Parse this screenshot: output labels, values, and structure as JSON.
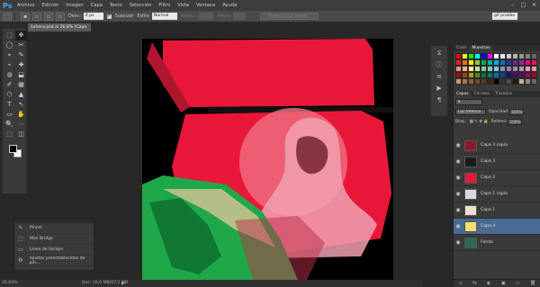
{
  "menubar": {
    "logo": "Ps",
    "items": [
      "Archivo",
      "Edición",
      "Imagen",
      "Capa",
      "Texto",
      "Selección",
      "Filtro",
      "Vista",
      "Ventana",
      "Ayuda"
    ],
    "win_controls": [
      "–",
      "□",
      "✕"
    ]
  },
  "options": {
    "difuminar_label": "Desv.:",
    "difuminar_value": "0 px",
    "suavizar_label": "Suavizar",
    "estilo_label": "Estilo:",
    "estilo_value": "Normal",
    "anchura_label": "Anchu.:",
    "altura_label": "Altura:",
    "refine_button": "Perfeccionar borde...",
    "preset_value": "gif prueba"
  },
  "document": {
    "tab_title": "liuhera.psd al 26,8% (Capa 4, RGB/8)",
    "tab_close": "×",
    "zoom": "26,84%",
    "doc_info": "Doc: 16,0 MB/67,2 MB"
  },
  "float_panel": {
    "items": [
      {
        "icon": "✎",
        "label": "Pincel"
      },
      {
        "icon": "⬚",
        "label": "Mini Bridge"
      },
      {
        "icon": "▭",
        "label": "Línea de tiempo"
      },
      {
        "icon": "⚙",
        "label": "Ajustes preestablecidos de pin..."
      }
    ]
  },
  "right_panel": {
    "color_tabs": [
      "Color",
      "Muestras"
    ],
    "layer_tabs": [
      "Capas",
      "Canales",
      "Trazados"
    ],
    "blend_mode": "Luz intensa",
    "opacity_label": "Opacidad:",
    "opacity_value": "100%",
    "lock_label": "Bloq.:",
    "fill_label": "Relleno:",
    "fill_value": "100%",
    "layers": [
      {
        "name": "Capa 3 copia",
        "color": "#8a1a2a",
        "selected": false
      },
      {
        "name": "Capa 3",
        "color": "#1a1a1a",
        "selected": false
      },
      {
        "name": "Capa 2",
        "color": "#e8173a",
        "selected": false
      },
      {
        "name": "Capa 1 copia",
        "color": "#d9d9d9",
        "selected": false
      },
      {
        "name": "Capa 1",
        "color": "#e8e0c8",
        "selected": false
      },
      {
        "name": "Capa 4",
        "color": "#f0e070",
        "selected": true
      },
      {
        "name": "Fondo",
        "color": "#2b6a5a",
        "selected": false
      }
    ],
    "footer_icons": [
      "∞",
      "fx",
      "◐",
      "▣",
      "▭",
      "🗑"
    ]
  },
  "swatch_colors": [
    "#ff0000",
    "#ffff00",
    "#00ff00",
    "#00ffff",
    "#0000ff",
    "#ff00ff",
    "#ffffff",
    "#e6e6e6",
    "#cccccc",
    "#b3b3b3",
    "#999999",
    "#808080",
    "#666666",
    "#ed1c24",
    "#f26522",
    "#fff200",
    "#8dc63f",
    "#00a651",
    "#00a99d",
    "#00aeef",
    "#0072bc",
    "#2e3192",
    "#662d91",
    "#92278f",
    "#ec008c",
    "#ed145b",
    "#f7977a",
    "#fbad82",
    "#fff799",
    "#c4df9b",
    "#82ca9c",
    "#7accc8",
    "#6dcff6",
    "#8393ca",
    "#8781bd",
    "#a187be",
    "#bd8cbf",
    "#f49ac1",
    "#f6989d",
    "#9e0b0f",
    "#a0410d",
    "#aba000",
    "#598527",
    "#007236",
    "#00746b",
    "#0076a3",
    "#004a80",
    "#1b1464",
    "#440e62",
    "#630460",
    "#9e005d",
    "#9e0039",
    "#c69c6d",
    "#a67c52",
    "#8c6239",
    "#754c24",
    "#603913",
    "#3c2415",
    "#000000",
    "#333333",
    "#4d4d4d",
    "#1a1a1a",
    "#c7b299",
    "#998675",
    "#736357"
  ],
  "tools": [
    "⬚",
    "✥",
    "◯",
    "✂",
    "⌖",
    "✎",
    "⌁",
    "✚",
    "◍",
    "⬓",
    "✐",
    "▦",
    "⬡",
    "▲",
    "T",
    "↖",
    "▭",
    "✋",
    "🔍",
    "⋯",
    "⬚",
    "◫"
  ]
}
